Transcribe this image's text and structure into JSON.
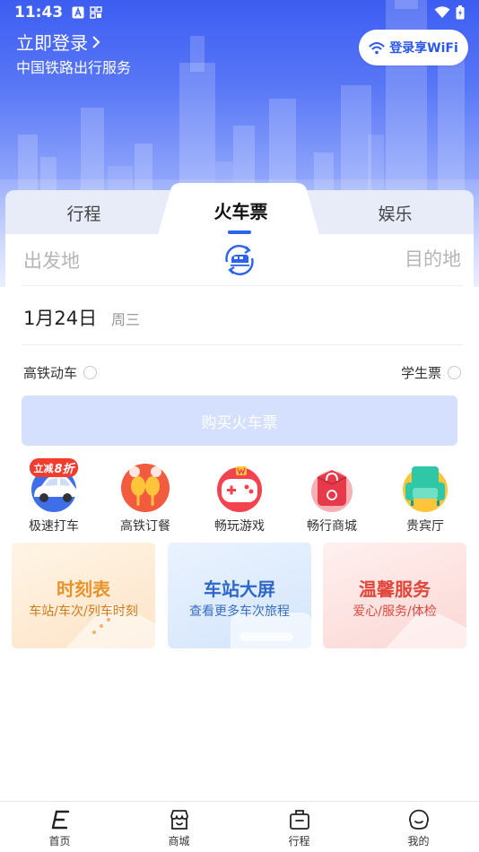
{
  "status_bar": {
    "time": "11:43"
  },
  "header": {
    "login_title": "立即登录",
    "login_subtitle": "中国铁路出行服务",
    "wifi_button": "登录享WiFi"
  },
  "tabs": [
    {
      "label": "行程",
      "active": false
    },
    {
      "label": "火车票",
      "active": true
    },
    {
      "label": "娱乐",
      "active": false
    }
  ],
  "booking": {
    "from_placeholder": "出发地",
    "to_placeholder": "目的地",
    "date": "1月24日",
    "weekday": "周三",
    "option_high_speed": "高铁动车",
    "option_student": "学生票",
    "buy_button": "购买火车票"
  },
  "services": [
    {
      "label": "极速打车",
      "icon": "car-icon"
    },
    {
      "label": "高铁订餐",
      "icon": "meal-icon"
    },
    {
      "label": "畅玩游戏",
      "icon": "game-icon"
    },
    {
      "label": "畅行商城",
      "icon": "shopping-bag-icon"
    },
    {
      "label": "贵宾厅",
      "icon": "sofa-icon"
    }
  ],
  "promo_badge": {
    "text": "立减",
    "discount": "8折"
  },
  "features": [
    {
      "title": "时刻表",
      "subtitle": "车站/车次/列车时刻",
      "color": "#e8922a"
    },
    {
      "title": "车站大屏",
      "subtitle": "查看更多车次旅程",
      "color": "#2e67c9"
    },
    {
      "title": "温馨服务",
      "subtitle": "爱心/服务/体检",
      "color": "#e0463a"
    }
  ],
  "bottom_nav": [
    {
      "label": "首页",
      "icon": "home-icon"
    },
    {
      "label": "商城",
      "icon": "store-icon"
    },
    {
      "label": "行程",
      "icon": "luggage-icon"
    },
    {
      "label": "我的",
      "icon": "profile-icon"
    }
  ],
  "colors": {
    "accent": "#2a63f0",
    "buy_button_disabled": "#d4e0fd"
  }
}
